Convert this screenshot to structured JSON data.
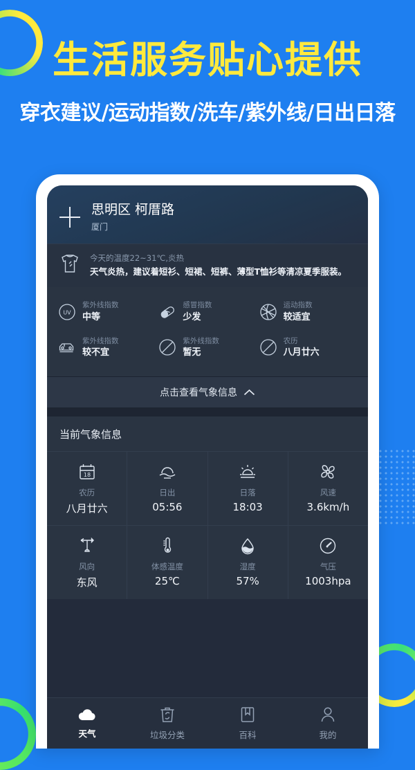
{
  "hero": {
    "title": "生活服务贴心提供",
    "subtitle": "穿衣建议/运动指数/洗车/紫外线/日出日落",
    "title_color": "#FFE93D",
    "subtitle_color": "#FFFFFF",
    "background_color": "#1E7FF0"
  },
  "app": {
    "header": {
      "add_label": "+",
      "location": "思明区 柯厝路",
      "city": "厦门"
    },
    "advice": {
      "summary": "今天的温度22~31℃,炎热",
      "detail": "天气炎热，建议着短衫、短裙、短裤、薄型T恤衫等清凉夏季服装。",
      "icon": "tshirt-icon"
    },
    "indices": [
      {
        "icon": "uv-circle-icon",
        "label": "紫外线指数",
        "value": "中等"
      },
      {
        "icon": "pill-icon",
        "label": "感冒指数",
        "value": "少发"
      },
      {
        "icon": "basketball-icon",
        "label": "运动指数",
        "value": "较适宜"
      },
      {
        "icon": "car-icon",
        "label": "紫外线指数",
        "value": "较不宜"
      },
      {
        "icon": "no-entry-icon",
        "label": "紫外线指数",
        "value": "暂无"
      },
      {
        "icon": "no-entry-icon",
        "label": "农历",
        "value": "八月廿六"
      }
    ],
    "expand_bar": {
      "label": "点击查看气象信息",
      "icon": "chevron-up-icon"
    },
    "section_title": "当前气象信息",
    "metrics": [
      {
        "icon": "calendar-icon",
        "label": "农历",
        "value": "八月廿六"
      },
      {
        "icon": "sunrise-icon",
        "label": "日出",
        "value": "05:56"
      },
      {
        "icon": "sunset-icon",
        "label": "日落",
        "value": "18:03"
      },
      {
        "icon": "fan-icon",
        "label": "风速",
        "value": "3.6km/h"
      },
      {
        "icon": "wind-vane-icon",
        "label": "风向",
        "value": "东风"
      },
      {
        "icon": "thermometer-icon",
        "label": "体感温度",
        "value": "25℃"
      },
      {
        "icon": "droplet-icon",
        "label": "湿度",
        "value": "57%"
      },
      {
        "icon": "gauge-icon",
        "label": "气压",
        "value": "1003hpa"
      }
    ],
    "tabs": [
      {
        "icon": "cloud-icon",
        "label": "天气",
        "active": true
      },
      {
        "icon": "trash-icon",
        "label": "垃圾分类",
        "active": false
      },
      {
        "icon": "book-icon",
        "label": "百科",
        "active": false
      },
      {
        "icon": "person-icon",
        "label": "我的",
        "active": false
      }
    ]
  }
}
